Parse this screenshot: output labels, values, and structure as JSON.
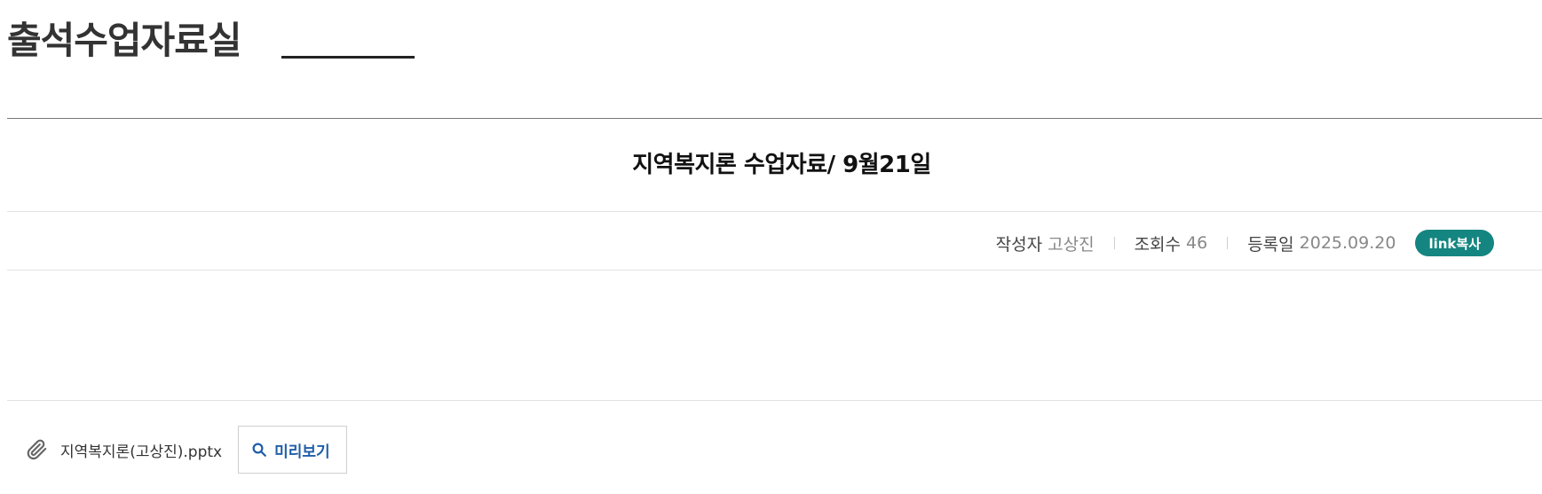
{
  "board": {
    "title": "출석수업자료실"
  },
  "post": {
    "title": "지역복지론 수업자료/ 9월21일",
    "meta": {
      "author_label": "작성자",
      "author_value": "고상진",
      "views_label": "조회수",
      "views_value": "46",
      "date_label": "등록일",
      "date_value": "2025.09.20"
    },
    "link_copy_label": "link복사"
  },
  "attachment": {
    "icon": "paperclip-icon",
    "file_name": "지역복지론(고상진).pptx",
    "preview_label": "미리보기",
    "preview_icon": "search-icon"
  },
  "colors": {
    "accent_teal": "#148580",
    "link_blue": "#1f5ea8"
  }
}
